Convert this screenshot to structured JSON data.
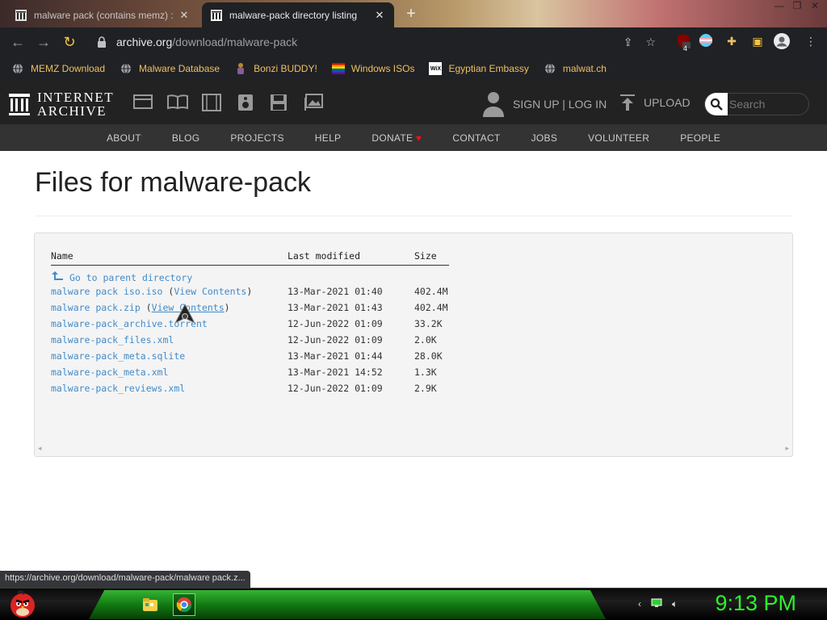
{
  "browser": {
    "tabs": [
      {
        "title": "malware pack (contains memz) :",
        "active": false
      },
      {
        "title": "malware-pack directory listing",
        "active": true
      }
    ],
    "new_tab": "+",
    "url_host": "archive.org",
    "url_path": "/download/malware-pack",
    "extension_badge": "4"
  },
  "bookmarks": [
    {
      "label": "MEMZ Download",
      "icon": "globe-icon"
    },
    {
      "label": "Malware Database",
      "icon": "globe-icon"
    },
    {
      "label": "Bonzi BUDDY!",
      "icon": "bonzi-icon"
    },
    {
      "label": "Windows ISOs",
      "icon": "windows-icon"
    },
    {
      "label": "Egyptian Embassy",
      "icon": "wix-icon"
    },
    {
      "label": "malwat.ch",
      "icon": "globe-icon"
    }
  ],
  "ia": {
    "logo_line1": "INTERNET",
    "logo_line2": "ARCHIVE",
    "signup_label": "SIGN UP | LOG IN",
    "upload_label": "UPLOAD",
    "search_placeholder": "Search",
    "nav": [
      "ABOUT",
      "BLOG",
      "PROJECTS",
      "HELP",
      "DONATE",
      "CONTACT",
      "JOBS",
      "VOLUNTEER",
      "PEOPLE"
    ]
  },
  "page": {
    "title": "Files for malware-pack",
    "columns": {
      "name": "Name",
      "modified": "Last modified",
      "size": "Size"
    },
    "parent_label": "Go to parent directory",
    "files": [
      {
        "name": "malware pack iso.iso",
        "extra_open": " (",
        "extra": "View Contents",
        "extra_close": ")",
        "modified": "13-Mar-2021 01:40",
        "size": "402.4M"
      },
      {
        "name": "malware pack.zip",
        "extra_open": " (",
        "extra": "View Contents",
        "extra_close": ")",
        "modified": "13-Mar-2021 01:43",
        "size": "402.4M"
      },
      {
        "name": "malware-pack_archive.torrent",
        "extra_open": "",
        "extra": "",
        "extra_close": "",
        "modified": "12-Jun-2022 01:09",
        "size": "33.2K"
      },
      {
        "name": "malware-pack_files.xml",
        "extra_open": "",
        "extra": "",
        "extra_close": "",
        "modified": "12-Jun-2022 01:09",
        "size": "2.0K"
      },
      {
        "name": "malware-pack_meta.sqlite",
        "extra_open": "",
        "extra": "",
        "extra_close": "",
        "modified": "13-Mar-2021 01:44",
        "size": "28.0K"
      },
      {
        "name": "malware-pack_meta.xml",
        "extra_open": "",
        "extra": "",
        "extra_close": "",
        "modified": "13-Mar-2021 14:52",
        "size": "1.3K"
      },
      {
        "name": "malware-pack_reviews.xml",
        "extra_open": "",
        "extra": "",
        "extra_close": "",
        "modified": "12-Jun-2022 01:09",
        "size": "2.9K"
      }
    ]
  },
  "status_url": "https://archive.org/download/malware-pack/malware pack.z...",
  "taskbar": {
    "clock": "9:13 PM"
  },
  "colors": {
    "link": "#428bca",
    "clock": "#2df22d",
    "bookmark_text": "#f0c060"
  }
}
